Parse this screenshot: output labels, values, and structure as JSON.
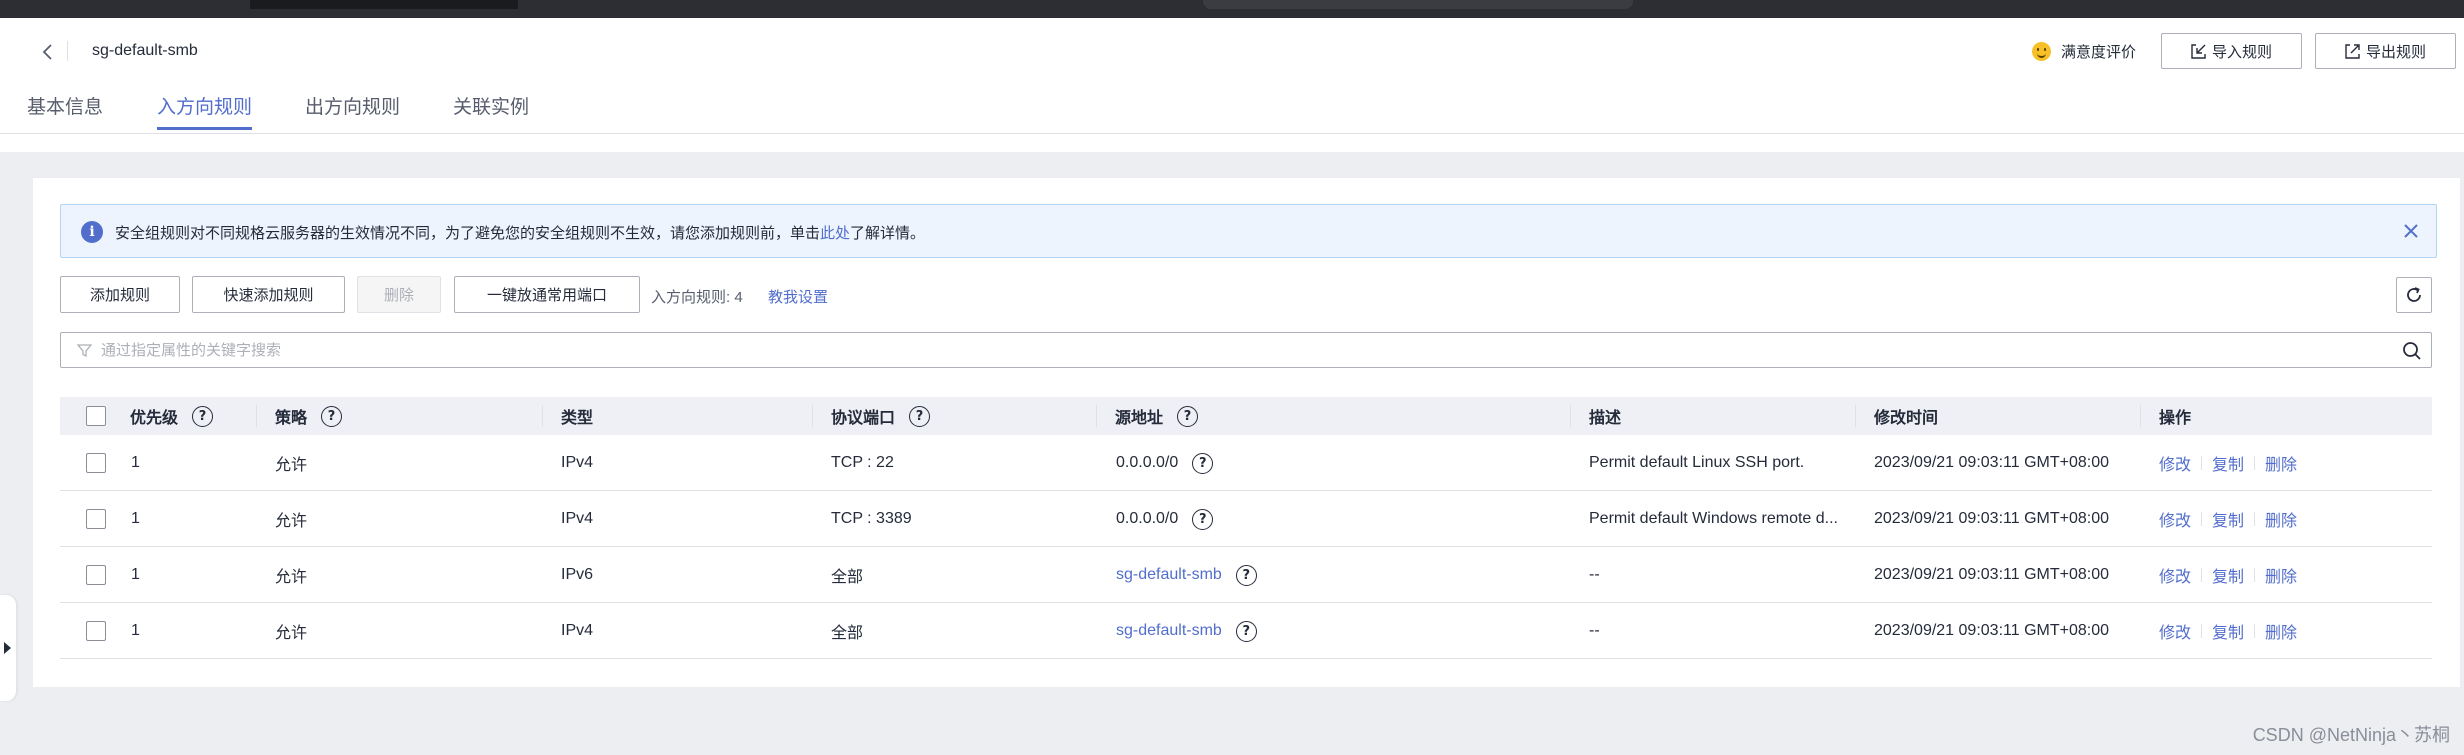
{
  "page_title": "sg-default-smb",
  "header": {
    "satisfaction_label": "满意度评价",
    "import_label": "导入规则",
    "export_label": "导出规则"
  },
  "tabs": [
    {
      "label": "基本信息",
      "active": false
    },
    {
      "label": "入方向规则",
      "active": true
    },
    {
      "label": "出方向规则",
      "active": false
    },
    {
      "label": "关联实例",
      "active": false
    }
  ],
  "alert": {
    "text_before": "安全组规则对不同规格云服务器的生效情况不同，为了避免您的安全组规则不生效，请您添加规则前，单击",
    "link": "此处",
    "text_after": "了解详情。"
  },
  "toolbar": {
    "add_rule": "添加规则",
    "quick_add": "快速添加规则",
    "delete": "删除",
    "open_common_ports": "一键放通常用端口",
    "rule_count": "入方向规则: 4",
    "teach_me": "教我设置"
  },
  "search": {
    "placeholder": "通过指定属性的关键字搜索"
  },
  "table": {
    "headers": {
      "priority": "优先级",
      "policy": "策略",
      "type": "类型",
      "protocol_port": "协议端口",
      "source": "源地址",
      "description": "描述",
      "modified": "修改时间",
      "actions": "操作"
    },
    "rows": [
      {
        "priority": "1",
        "policy": "允许",
        "type": "IPv4",
        "protocol_port": "TCP : 22",
        "source": "0.0.0.0/0",
        "source_is_link": false,
        "description": "Permit default Linux SSH port.",
        "modified": "2023/09/21 09:03:11 GMT+08:00"
      },
      {
        "priority": "1",
        "policy": "允许",
        "type": "IPv4",
        "protocol_port": "TCP : 3389",
        "source": "0.0.0.0/0",
        "source_is_link": false,
        "description": "Permit default Windows remote d...",
        "modified": "2023/09/21 09:03:11 GMT+08:00"
      },
      {
        "priority": "1",
        "policy": "允许",
        "type": "IPv6",
        "protocol_port": "全部",
        "source": "sg-default-smb",
        "source_is_link": true,
        "description": "--",
        "modified": "2023/09/21 09:03:11 GMT+08:00"
      },
      {
        "priority": "1",
        "policy": "允许",
        "type": "IPv4",
        "protocol_port": "全部",
        "source": "sg-default-smb",
        "source_is_link": true,
        "description": "--",
        "modified": "2023/09/21 09:03:11 GMT+08:00"
      }
    ],
    "actions": {
      "edit": "修改",
      "copy": "复制",
      "delete": "删除"
    }
  },
  "watermark": "CSDN @NetNinja丶苏桐",
  "colors": {
    "accent": "#526ecc",
    "alert_bg": "#edf4fe",
    "table_header_bg": "#eef0f5",
    "page_bg": "#edeef1"
  }
}
